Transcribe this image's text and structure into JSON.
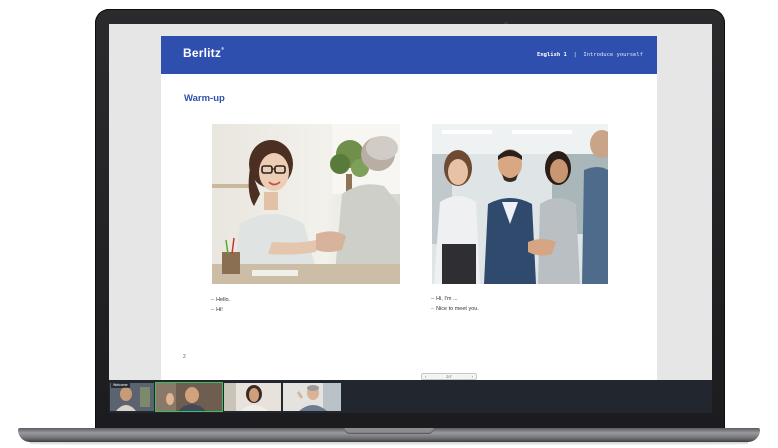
{
  "slide": {
    "brand": "Berlitz",
    "course": "English 1",
    "topic": "Introduce yourself",
    "section_title": "Warm-up",
    "page_number": "2",
    "left_dialog": [
      "Hello.",
      "Hi!"
    ],
    "right_dialog": [
      "Hi, I'm ...",
      "Nice to meet you."
    ]
  },
  "pager": {
    "prev_icon": "chevron-left-icon",
    "label": "2/7",
    "next_icon": "chevron-right-icon"
  },
  "video_strip": {
    "self_label": "Welcome",
    "participants": 4
  },
  "colors": {
    "brand_blue": "#2f4fae",
    "accent_green": "#2aa84a",
    "strip_bg": "#22272f"
  }
}
